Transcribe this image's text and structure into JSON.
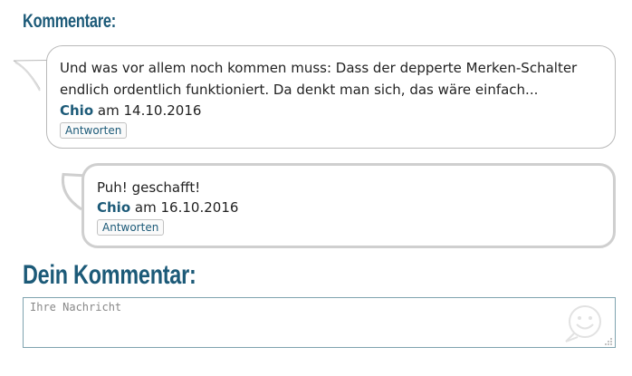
{
  "comments_section": {
    "title": "Kommentare:"
  },
  "comments": [
    {
      "text": "Und was vor allem noch kommen muss: Dass der depperte Merken-Schalter endlich ordentlich funktioniert. Da denkt man sich, das wäre einfach...",
      "author": "Chio",
      "date_prefix": "am",
      "date": "14.10.2016",
      "reply_label": "Antworten"
    },
    {
      "text": "Puh! geschafft!",
      "author": "Chio",
      "date_prefix": "am",
      "date": "16.10.2016",
      "reply_label": "Antworten"
    }
  ],
  "compose": {
    "title": "Dein Kommentar:",
    "placeholder": "Ihre Nachricht",
    "value": "",
    "emoji_icon": "smiley-icon",
    "resize_icon": "resize-grip-icon"
  },
  "colors": {
    "accent": "#1c5a78",
    "bubble_border": "#b9b9b9",
    "reply_bubble_border": "#cfcfcf",
    "textarea_border": "#7fa3af"
  }
}
